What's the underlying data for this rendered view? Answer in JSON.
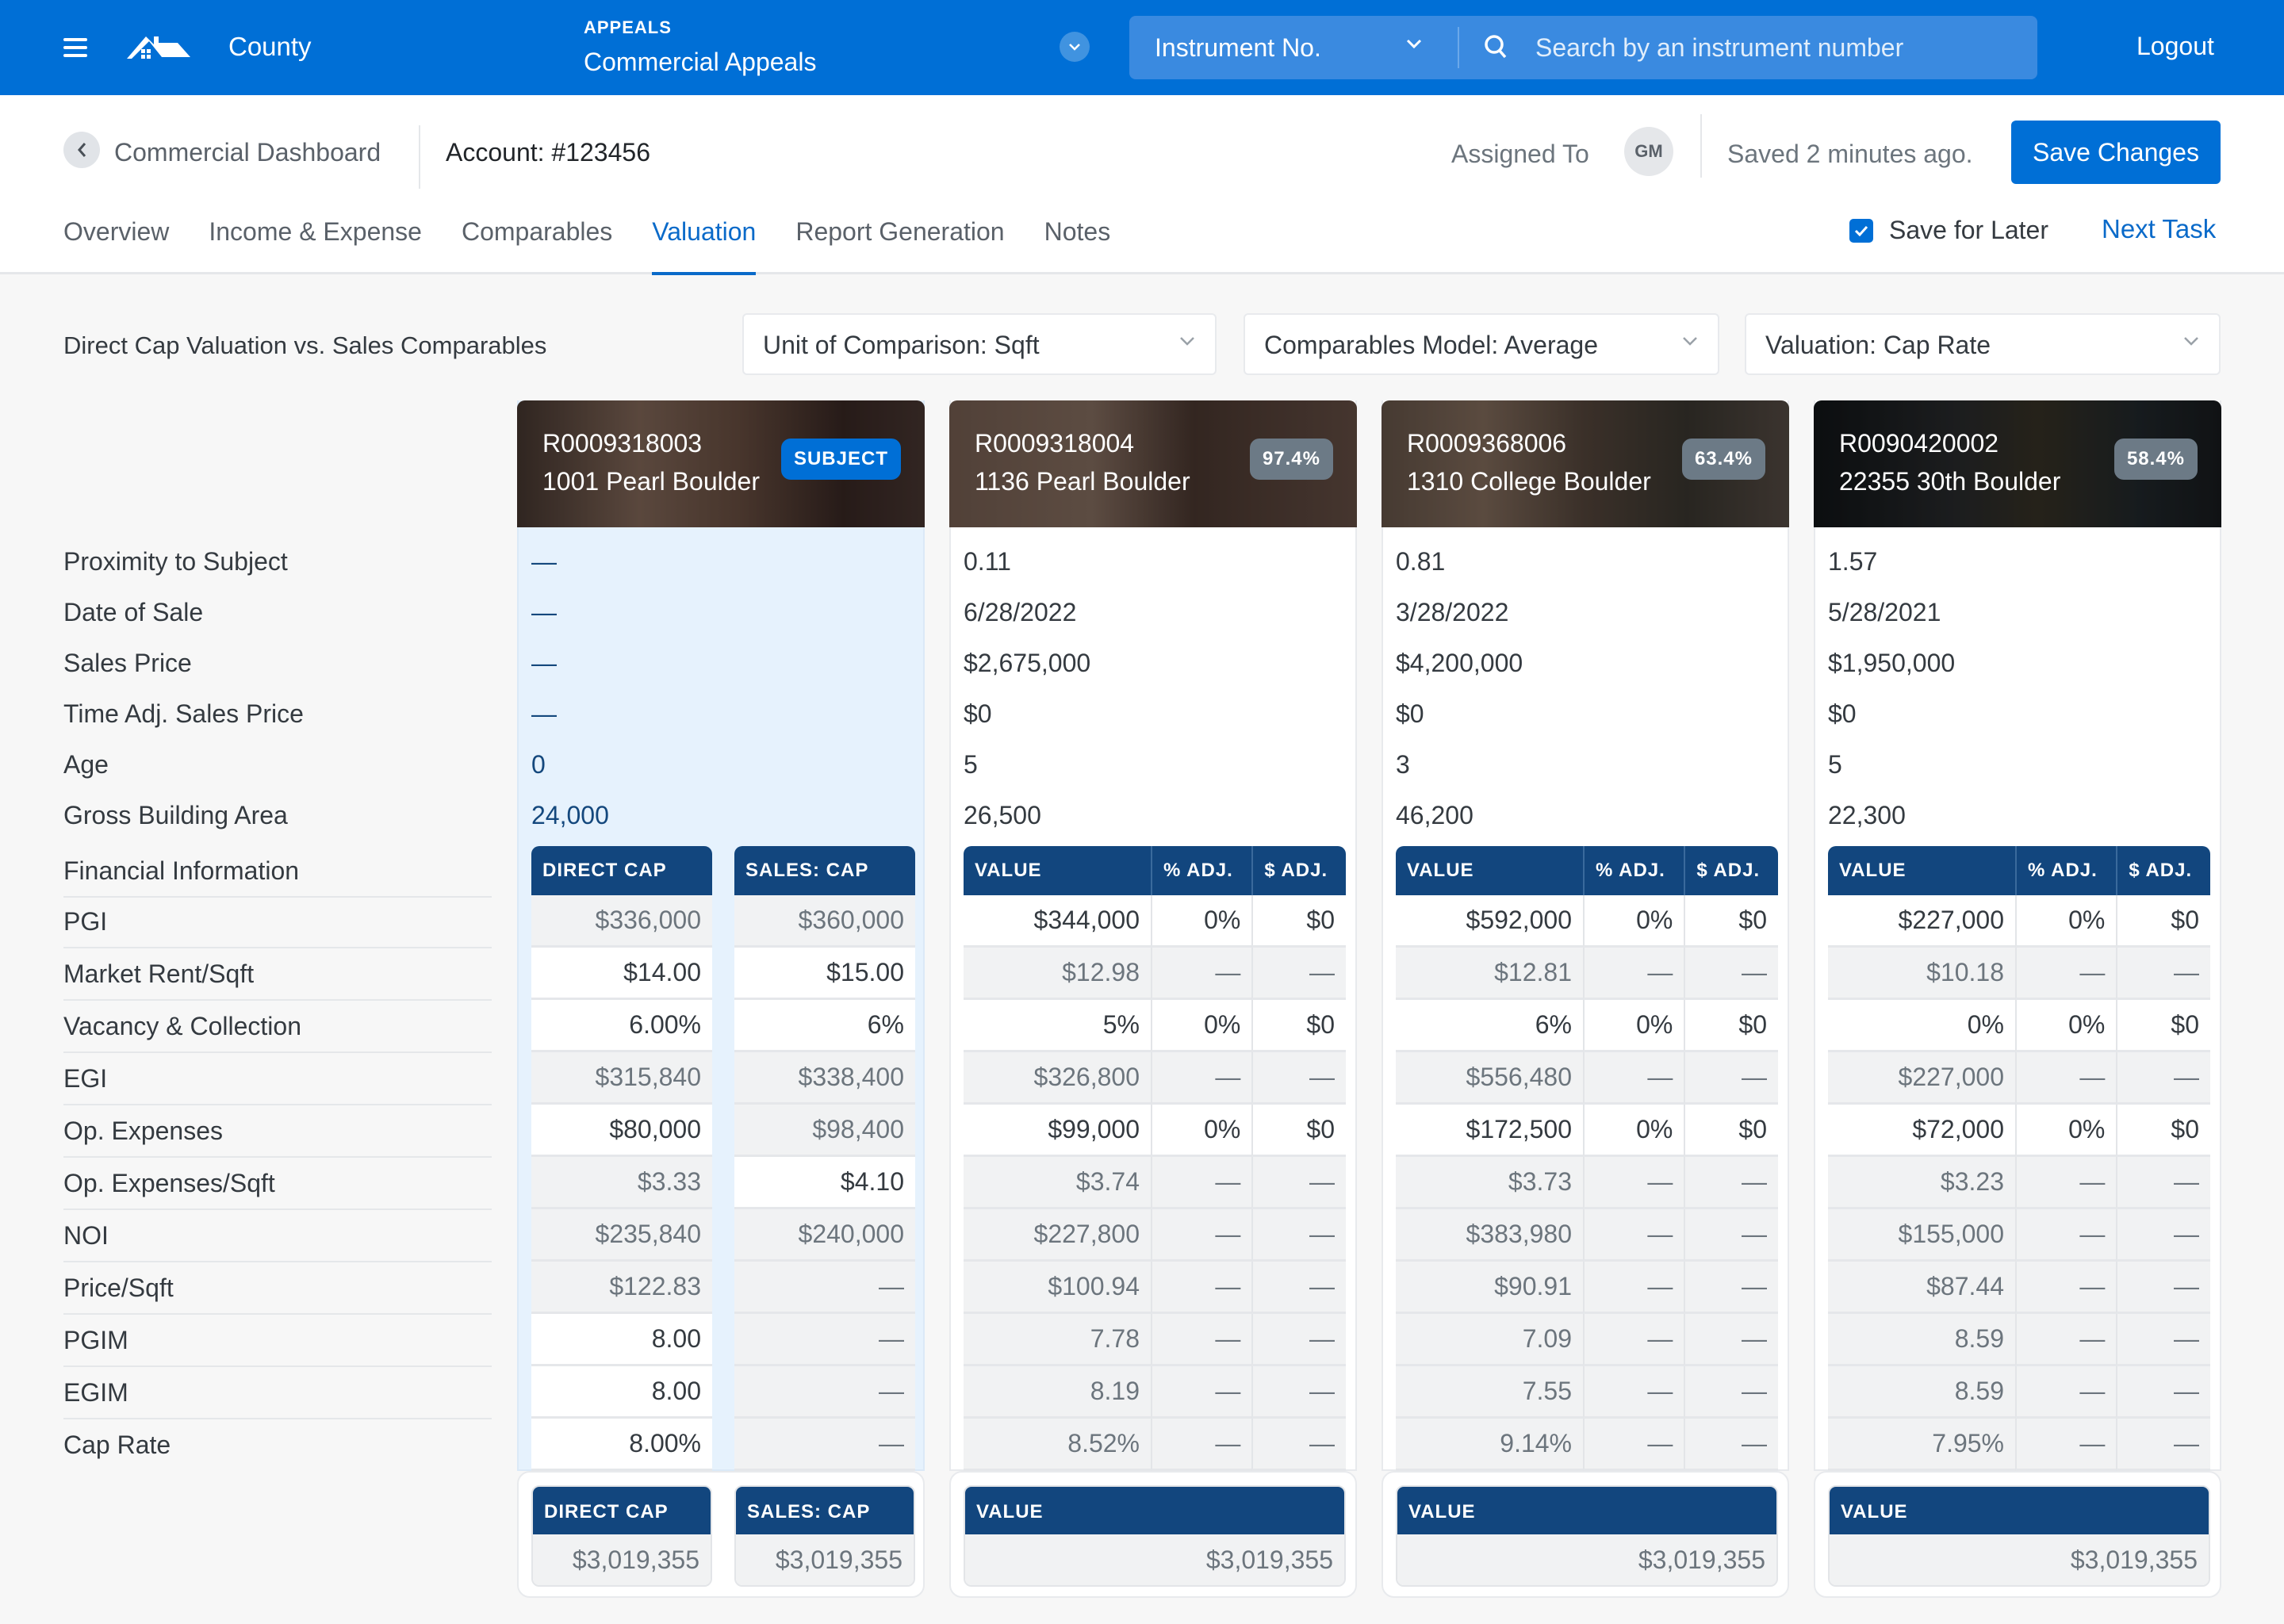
{
  "header": {
    "brand": "County",
    "module_kicker": "APPEALS",
    "module_title": "Commercial Appeals",
    "search_type": "Instrument No.",
    "search_placeholder": "Search by an instrument number",
    "logout": "Logout",
    "brand_color": "#006fd6"
  },
  "subheader": {
    "breadcrumb": "Commercial Dashboard",
    "account": "Account: #123456",
    "assigned_label": "Assigned To",
    "assignee_initials": "GM",
    "saved_status": "Saved 2 minutes ago.",
    "save_button": "Save Changes",
    "save_for_later": "Save for Later",
    "save_for_later_checked": true,
    "next_task": "Next Task",
    "tabs": [
      {
        "label": "Overview",
        "active": false
      },
      {
        "label": "Income & Expense",
        "active": false
      },
      {
        "label": "Comparables",
        "active": false
      },
      {
        "label": "Valuation",
        "active": true
      },
      {
        "label": "Report Generation",
        "active": false
      },
      {
        "label": "Notes",
        "active": false
      }
    ]
  },
  "toolbar": {
    "title": "Direct Cap Valuation vs. Sales Comparables",
    "unit_dropdown": "Unit of Comparison: Sqft",
    "model_dropdown": "Comparables Model: Average",
    "valuation_dropdown": "Valuation: Cap Rate"
  },
  "property_labels": [
    "Proximity to Subject",
    "Date of Sale",
    "Sales Price",
    "Time Adj. Sales Price",
    "Age",
    "Gross Building Area"
  ],
  "financial_heading": "Financial Information",
  "financial_labels": [
    "PGI",
    "Market Rent/Sqft",
    "Vacancy & Collection",
    "EGI",
    "Op. Expenses",
    "Op. Expenses/Sqft",
    "NOI",
    "Price/Sqft",
    "PGIM",
    "EGIM",
    "Cap Rate"
  ],
  "subject": {
    "id": "R0009318003",
    "address": "1001 Pearl Boulder",
    "badge": "SUBJECT",
    "properties": [
      "—",
      "—",
      "—",
      "—",
      "0",
      "24,000"
    ],
    "direct_cap_header": "DIRECT CAP",
    "sales_cap_header": "SALES: CAP",
    "direct_cap": [
      {
        "v": "$336,000",
        "edit": false
      },
      {
        "v": "$14.00",
        "edit": true
      },
      {
        "v": "6.00%",
        "edit": true
      },
      {
        "v": "$315,840",
        "edit": false
      },
      {
        "v": "$80,000",
        "edit": true
      },
      {
        "v": "$3.33",
        "edit": false
      },
      {
        "v": "$235,840",
        "edit": false
      },
      {
        "v": "$122.83",
        "edit": false
      },
      {
        "v": "8.00",
        "edit": true
      },
      {
        "v": "8.00",
        "edit": true
      },
      {
        "v": "8.00%",
        "edit": true
      }
    ],
    "sales_cap": [
      {
        "v": "$360,000",
        "edit": false
      },
      {
        "v": "$15.00",
        "edit": true
      },
      {
        "v": "6%",
        "edit": true
      },
      {
        "v": "$338,400",
        "edit": false
      },
      {
        "v": "$98,400",
        "edit": false
      },
      {
        "v": "$4.10",
        "edit": true
      },
      {
        "v": "$240,000",
        "edit": false
      },
      {
        "v": "—",
        "edit": false
      },
      {
        "v": "—",
        "edit": false
      },
      {
        "v": "—",
        "edit": false
      },
      {
        "v": "—",
        "edit": false
      }
    ],
    "footer_direct_cap": "$3,019,355",
    "footer_sales_cap": "$3,019,355"
  },
  "comparable_headers": {
    "value": "VALUE",
    "pct_adj": "% ADJ.",
    "dollar_adj": "$ ADJ."
  },
  "comparables": [
    {
      "id": "R0009318004",
      "address": "1136 Pearl Boulder",
      "match": "97.4%",
      "properties": [
        "0.11",
        "6/28/2022",
        "$2,675,000",
        "$0",
        "5",
        "26,500"
      ],
      "rows": [
        {
          "v": "$344,000",
          "p": "0%",
          "d": "$0",
          "edit": true
        },
        {
          "v": "$12.98",
          "p": "—",
          "d": "—",
          "edit": false
        },
        {
          "v": "5%",
          "p": "0%",
          "d": "$0",
          "edit": true
        },
        {
          "v": "$326,800",
          "p": "—",
          "d": "—",
          "edit": false
        },
        {
          "v": "$99,000",
          "p": "0%",
          "d": "$0",
          "edit": true
        },
        {
          "v": "$3.74",
          "p": "—",
          "d": "—",
          "edit": false
        },
        {
          "v": "$227,800",
          "p": "—",
          "d": "—",
          "edit": false
        },
        {
          "v": "$100.94",
          "p": "—",
          "d": "—",
          "edit": false
        },
        {
          "v": "7.78",
          "p": "—",
          "d": "—",
          "edit": false
        },
        {
          "v": "8.19",
          "p": "—",
          "d": "—",
          "edit": false
        },
        {
          "v": "8.52%",
          "p": "—",
          "d": "—",
          "edit": false
        }
      ],
      "footer_value": "$3,019,355"
    },
    {
      "id": "R0009368006",
      "address": "1310 College Boulder",
      "match": "63.4%",
      "properties": [
        "0.81",
        "3/28/2022",
        "$4,200,000",
        "$0",
        "3",
        "46,200"
      ],
      "rows": [
        {
          "v": "$592,000",
          "p": "0%",
          "d": "$0",
          "edit": true
        },
        {
          "v": "$12.81",
          "p": "—",
          "d": "—",
          "edit": false
        },
        {
          "v": "6%",
          "p": "0%",
          "d": "$0",
          "edit": true
        },
        {
          "v": "$556,480",
          "p": "—",
          "d": "—",
          "edit": false
        },
        {
          "v": "$172,500",
          "p": "0%",
          "d": "$0",
          "edit": true
        },
        {
          "v": "$3.73",
          "p": "—",
          "d": "—",
          "edit": false
        },
        {
          "v": "$383,980",
          "p": "—",
          "d": "—",
          "edit": false
        },
        {
          "v": "$90.91",
          "p": "—",
          "d": "—",
          "edit": false
        },
        {
          "v": "7.09",
          "p": "—",
          "d": "—",
          "edit": false
        },
        {
          "v": "7.55",
          "p": "—",
          "d": "—",
          "edit": false
        },
        {
          "v": "9.14%",
          "p": "—",
          "d": "—",
          "edit": false
        }
      ],
      "footer_value": "$3,019,355"
    },
    {
      "id": "R0090420002",
      "address": "22355 30th Boulder",
      "match": "58.4%",
      "properties": [
        "1.57",
        "5/28/2021",
        "$1,950,000",
        "$0",
        "5",
        "22,300"
      ],
      "rows": [
        {
          "v": "$227,000",
          "p": "0%",
          "d": "$0",
          "edit": true
        },
        {
          "v": "$10.18",
          "p": "—",
          "d": "—",
          "edit": false
        },
        {
          "v": "0%",
          "p": "0%",
          "d": "$0",
          "edit": true
        },
        {
          "v": "$227,000",
          "p": "—",
          "d": "—",
          "edit": false
        },
        {
          "v": "$72,000",
          "p": "0%",
          "d": "$0",
          "edit": true
        },
        {
          "v": "$3.23",
          "p": "—",
          "d": "—",
          "edit": false
        },
        {
          "v": "$155,000",
          "p": "—",
          "d": "—",
          "edit": false
        },
        {
          "v": "$87.44",
          "p": "—",
          "d": "—",
          "edit": false
        },
        {
          "v": "8.59",
          "p": "—",
          "d": "—",
          "edit": false
        },
        {
          "v": "8.59",
          "p": "—",
          "d": "—",
          "edit": false
        },
        {
          "v": "7.95%",
          "p": "—",
          "d": "—",
          "edit": false
        }
      ],
      "footer_value": "$3,019,355"
    }
  ]
}
